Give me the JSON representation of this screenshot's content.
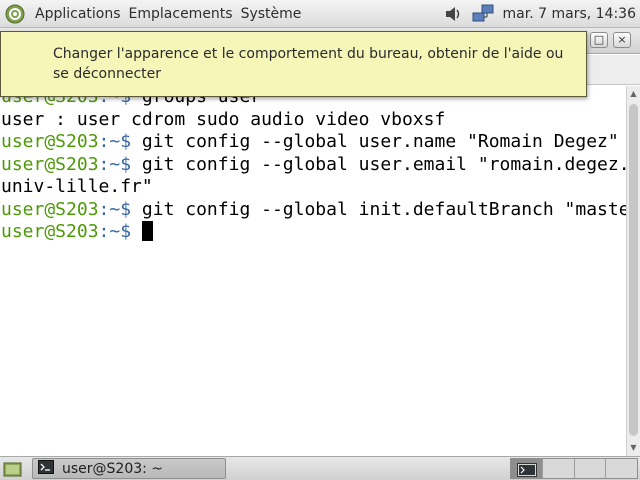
{
  "top_panel": {
    "menus": [
      "Applications",
      "Emplacements",
      "Système"
    ],
    "clock": "mar. 7 mars, 14:36",
    "icons": [
      "menu-logo-icon",
      "volume-icon",
      "network-icon"
    ]
  },
  "terminal_window": {
    "buttons": {
      "minimize": "–",
      "maximize": "□",
      "close": "×"
    }
  },
  "tooltip": {
    "text": "Changer l'apparence et le comportement du bureau, obtenir de l'aide ou se déconnecter"
  },
  "terminal": {
    "prompt_user": "user@S203",
    "prompt_sep": ":~$ ",
    "lines": [
      {
        "kind": "prompt",
        "text": "groups user"
      },
      {
        "kind": "output",
        "text": "user : user cdrom sudo audio video vboxsf"
      },
      {
        "kind": "prompt",
        "text": "git config --global user.name \"Romain Degez\""
      },
      {
        "kind": "prompt",
        "text": "git config --global user.email \"romain.degez.etu@"
      },
      {
        "kind": "output",
        "text": "univ-lille.fr\""
      },
      {
        "kind": "prompt",
        "text": "git config --global init.defaultBranch \"master\""
      },
      {
        "kind": "prompt",
        "text": ""
      }
    ]
  },
  "bottom_panel": {
    "taskbar_label": "user@S203: ~",
    "workspaces": 4,
    "active_workspace": 1
  },
  "colors": {
    "prompt_user": "#4e9a06",
    "prompt_sep": "#3465a4",
    "tooltip_bg": "#f6f6b9"
  }
}
